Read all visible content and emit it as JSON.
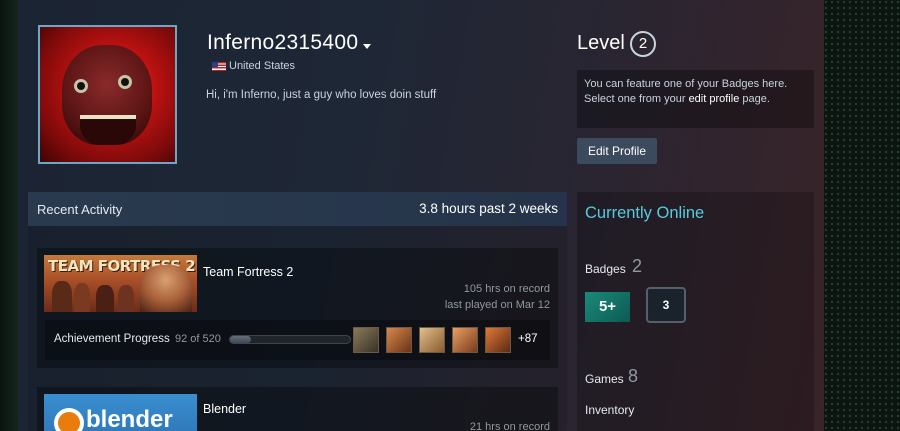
{
  "profile": {
    "username": "Inferno2315400",
    "country": "United States",
    "summary": "Hi, i'm Inferno, just a guy who loves doin stuff"
  },
  "level": {
    "label": "Level",
    "value": "2",
    "badge_info_line1": "You can feature one of your Badges here.",
    "badge_info_line2_prefix": "Select one from your ",
    "badge_info_link": "edit profile",
    "badge_info_line2_suffix": " page.",
    "edit_button": "Edit Profile"
  },
  "recent_activity": {
    "title": "Recent Activity",
    "hours_summary": "3.8 hours past 2 weeks",
    "games": [
      {
        "name": "Team Fortress 2",
        "capsule_text": "TEAM FORTRESS 2",
        "hours_on_record": "105 hrs on record",
        "last_played": "last played on Mar 12",
        "achievement_label": "Achievement Progress",
        "achievement_count": "92 of 520",
        "achievement_progress": 0.177,
        "achievement_more": "+87"
      },
      {
        "name": "Blender",
        "capsule_text": "blender",
        "hours_on_record": "21 hrs on record"
      }
    ]
  },
  "sidebar": {
    "status": "Currently Online",
    "badges_label": "Badges",
    "badges_count": "2",
    "badge_1_text": "5+",
    "badge_2_text": "3",
    "games_label": "Games",
    "games_count": "8",
    "inventory_label": "Inventory"
  },
  "colors": {
    "online_status": "#57cbde",
    "accent_blue": "#6fa6c8"
  }
}
